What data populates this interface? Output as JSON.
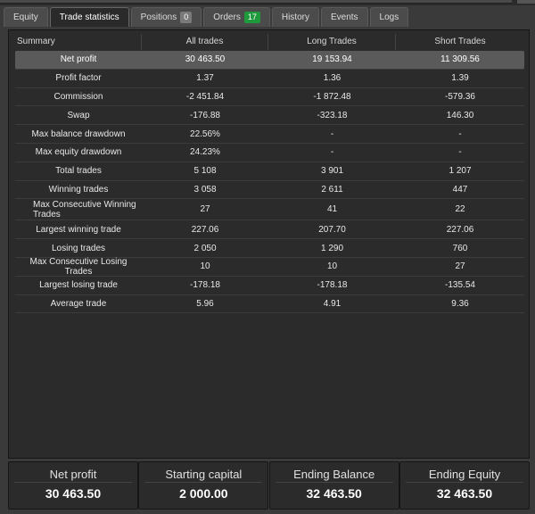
{
  "tabs": [
    {
      "label": "Equity"
    },
    {
      "label": "Trade statistics",
      "active": true
    },
    {
      "label": "Positions",
      "badge": "0"
    },
    {
      "label": "Orders",
      "badge": "17"
    },
    {
      "label": "History"
    },
    {
      "label": "Events"
    },
    {
      "label": "Logs"
    }
  ],
  "table": {
    "headers": [
      "Summary",
      "All trades",
      "Long Trades",
      "Short Trades"
    ],
    "rows": [
      [
        "Net profit",
        "30 463.50",
        "19 153.94",
        "11 309.56"
      ],
      [
        "Profit factor",
        "1.37",
        "1.36",
        "1.39"
      ],
      [
        "Commission",
        "-2 451.84",
        "-1 872.48",
        "-579.36"
      ],
      [
        "Swap",
        "-176.88",
        "-323.18",
        "146.30"
      ],
      [
        "Max balance drawdown",
        "22.56%",
        "-",
        "-"
      ],
      [
        "Max equity drawdown",
        "24.23%",
        "-",
        "-"
      ],
      [
        "Total trades",
        "5 108",
        "3 901",
        "1 207"
      ],
      [
        "Winning trades",
        "3 058",
        "2 611",
        "447"
      ],
      [
        "Max Consecutive Winning Trades",
        "27",
        "41",
        "22"
      ],
      [
        "Largest winning trade",
        "227.06",
        "207.70",
        "227.06"
      ],
      [
        "Losing trades",
        "2 050",
        "1 290",
        "760"
      ],
      [
        "Max Consecutive Losing Trades",
        "10",
        "10",
        "27"
      ],
      [
        "Largest losing trade",
        "-178.18",
        "-178.18",
        "-135.54"
      ],
      [
        "Average trade",
        "5.96",
        "4.91",
        "9.36"
      ]
    ]
  },
  "summary": {
    "net_profit_label": "Net profit",
    "net_profit_value": "30 463.50",
    "starting_capital_label": "Starting capital",
    "starting_capital_value": "2 000.00",
    "ending_balance_label": "Ending Balance",
    "ending_balance_value": "32 463.50",
    "ending_equity_label": "Ending Equity",
    "ending_equity_value": "32 463.50"
  },
  "colors": {
    "background": "#3a3a3a",
    "panel": "#2b2b2b",
    "selected_row": "#5a5a5a",
    "badge_orders": "#1e9a3c",
    "badge_positions": "#7a7a7a"
  }
}
